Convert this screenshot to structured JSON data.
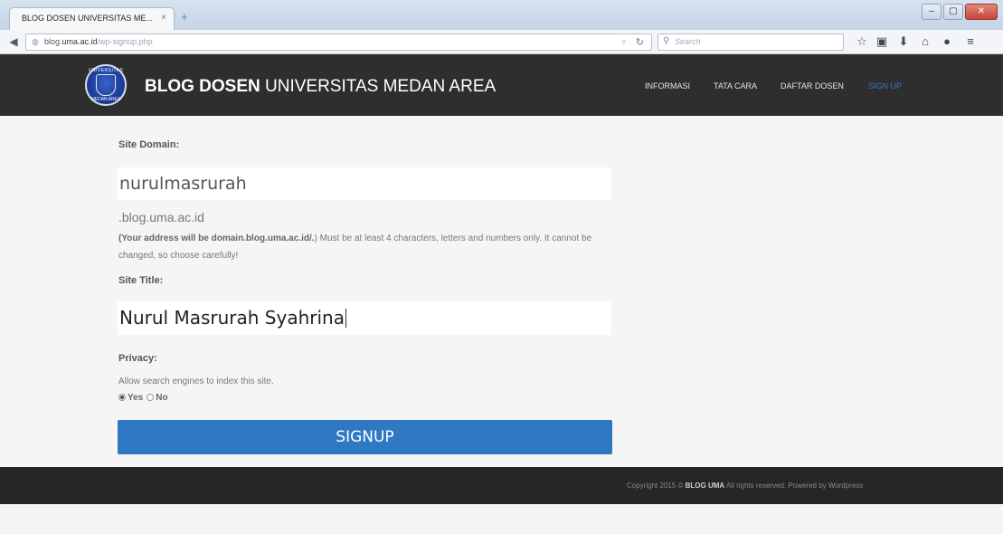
{
  "browser": {
    "tab_title": "BLOG DOSEN UNIVERSITAS ME...",
    "tab_close": "×",
    "new_tab": "+",
    "url_host": "blog.",
    "url_domain": "uma.ac.id",
    "url_path": "/wp-signup.php",
    "search_placeholder": "Search",
    "window_controls": {
      "minimize": "–",
      "maximize": "▢",
      "close": "✕"
    },
    "toolbar_icons": [
      "star-icon",
      "clipboard-icon",
      "download-icon",
      "home-icon",
      "chat-icon",
      "menu-icon"
    ]
  },
  "header": {
    "logo_text_top": "UNIVERSITAS",
    "logo_text_bottom": "MEDAN AREA",
    "title_bold": "BLOG DOSEN",
    "title_rest": " UNIVERSITAS MEDAN AREA",
    "nav": [
      "INFORMASI",
      "TATA CARA",
      "DAFTAR DOSEN",
      "SIGN UP"
    ]
  },
  "form": {
    "domain_label": "Site Domain:",
    "domain_value": "nurulmasrurah",
    "domain_suffix": ".blog.uma.ac.id",
    "domain_help_bold": "(Your address will be domain.blog.uma.ac.id/.",
    "domain_help_rest": ") Must be at least 4 characters, letters and numbers only. It cannot be changed, so choose carefully!",
    "title_label": "Site Title:",
    "title_value": "Nurul Masrurah Syahrina",
    "privacy_label": "Privacy:",
    "privacy_text": "Allow search engines to index this site.",
    "privacy_yes": "Yes",
    "privacy_no": "No",
    "privacy_selected": "Yes",
    "submit_label": "SIGNUP"
  },
  "footer": {
    "prefix": "Copyright 2015 © ",
    "brand": "BLOG UMA",
    "suffix": " All rights reserved. Powered by Wordpress"
  },
  "colors": {
    "header_bg": "#2e2e2e",
    "accent_blue": "#2e78c4",
    "active_nav": "#3a74c7",
    "page_bg": "#f5f5f5"
  }
}
